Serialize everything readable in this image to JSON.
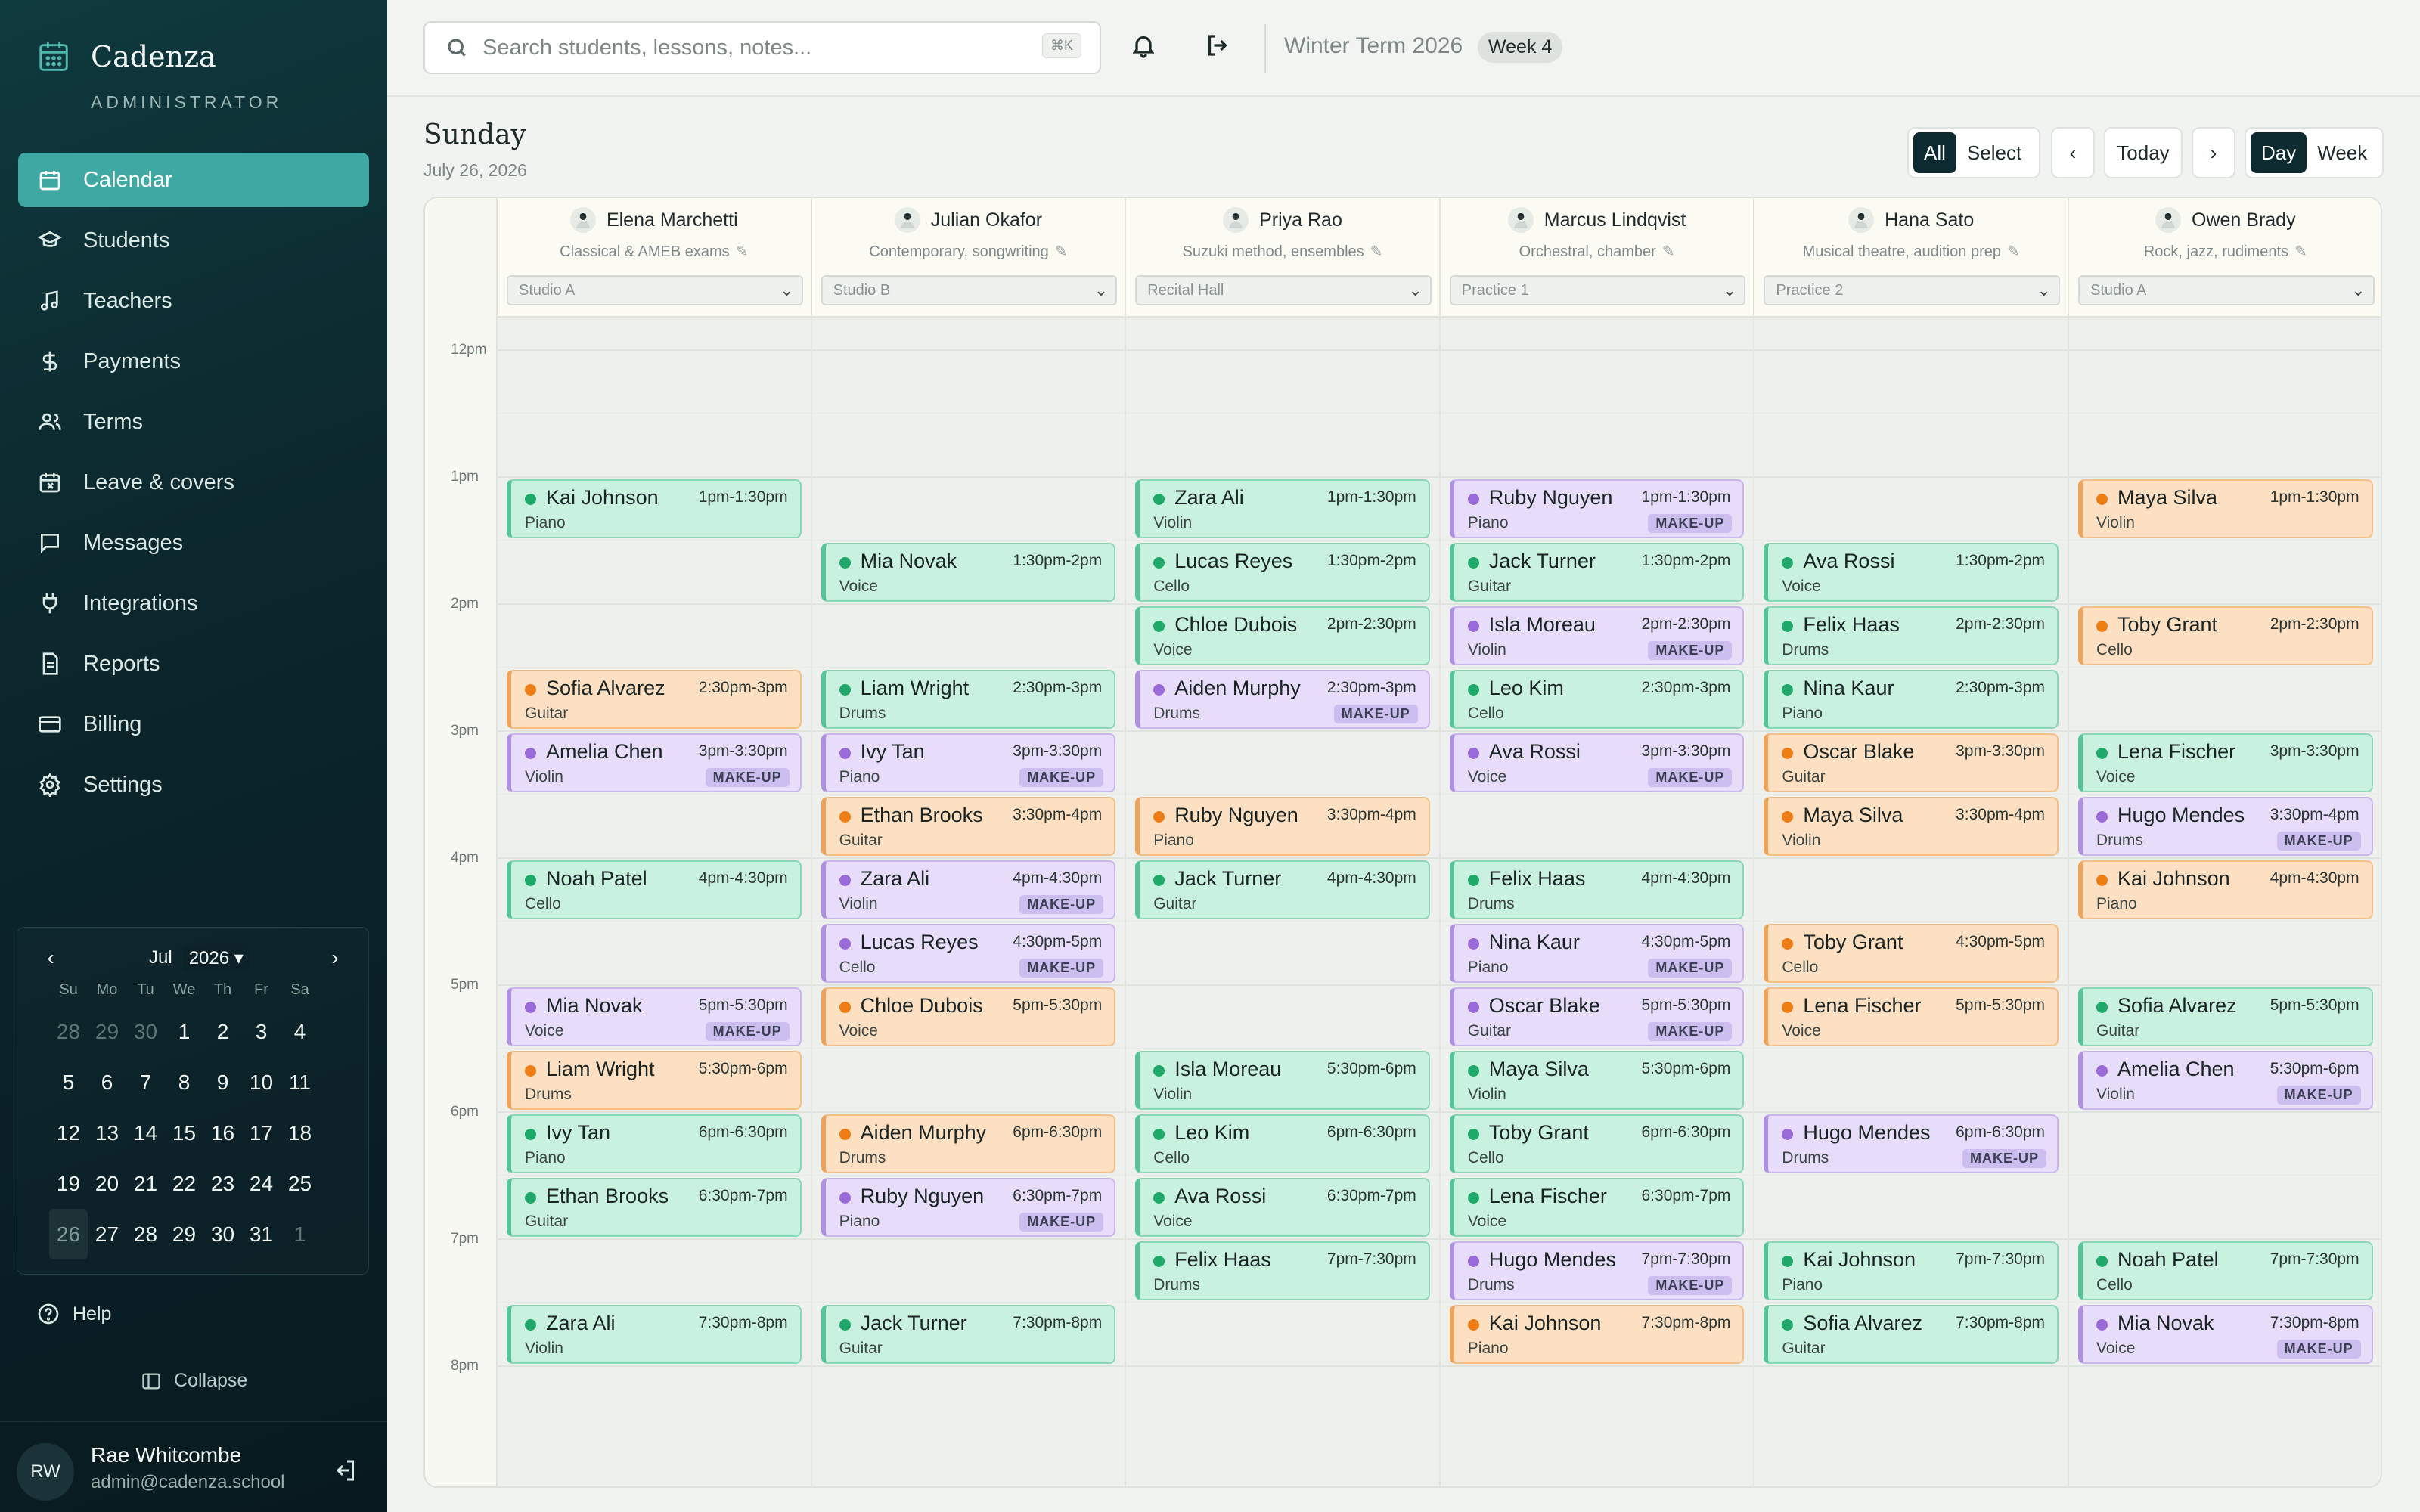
{
  "app": {
    "name": "Cadenza",
    "role": "ADMINISTRATOR"
  },
  "nav": [
    {
      "label": "Calendar",
      "icon": "calendar-icon",
      "active": true
    },
    {
      "label": "Students",
      "icon": "graduation-cap-icon"
    },
    {
      "label": "Teachers",
      "icon": "music-note-icon"
    },
    {
      "label": "Payments",
      "icon": "dollar-icon"
    },
    {
      "label": "Terms",
      "icon": "users-icon"
    },
    {
      "label": "Leave & covers",
      "icon": "calendar-x-icon"
    },
    {
      "label": "Messages",
      "icon": "message-icon"
    },
    {
      "label": "Integrations",
      "icon": "plug-icon"
    },
    {
      "label": "Reports",
      "icon": "document-icon"
    },
    {
      "label": "Billing",
      "icon": "credit-card-icon"
    },
    {
      "label": "Settings",
      "icon": "gear-icon"
    }
  ],
  "mini_calendar": {
    "month": "Jul",
    "year": "2026",
    "dow": [
      "Su",
      "Mo",
      "Tu",
      "We",
      "Th",
      "Fr",
      "Sa"
    ],
    "days": [
      "28",
      "29",
      "30",
      "1",
      "2",
      "3",
      "4",
      "5",
      "6",
      "7",
      "8",
      "9",
      "10",
      "11",
      "12",
      "13",
      "14",
      "15",
      "16",
      "17",
      "18",
      "19",
      "20",
      "21",
      "22",
      "23",
      "24",
      "25",
      "26",
      "27",
      "28",
      "29",
      "30",
      "31",
      "1"
    ],
    "muted": [
      0,
      1,
      2,
      34
    ],
    "today_index": 28
  },
  "help_label": "Help",
  "collapse_label": "Collapse",
  "user": {
    "initials": "RW",
    "name": "Rae Whitcombe",
    "email": "admin@cadenza.school"
  },
  "topbar": {
    "search_placeholder": "Search students, lessons, notes...",
    "shortcut": "⌘K",
    "term": "Winter Term 2026",
    "week": "Week 4"
  },
  "day": {
    "title": "Sunday",
    "date": "July 26, 2026"
  },
  "controls": {
    "all": "All",
    "select": "Select",
    "prev": "‹",
    "today": "Today",
    "next": "›",
    "day": "Day",
    "week": "Week"
  },
  "time_labels": [
    "12pm",
    "1pm",
    "2pm",
    "3pm",
    "4pm",
    "5pm",
    "6pm",
    "7pm",
    "8pm"
  ],
  "teachers": [
    {
      "name": "Elena Marchetti",
      "specialty": "Classical & AMEB exams",
      "room": "Studio A"
    },
    {
      "name": "Julian Okafor",
      "specialty": "Contemporary, songwriting",
      "room": "Studio B"
    },
    {
      "name": "Priya Rao",
      "specialty": "Suzuki method, ensembles",
      "room": "Recital Hall"
    },
    {
      "name": "Marcus Lindqvist",
      "specialty": "Orchestral, chamber",
      "room": "Practice 1"
    },
    {
      "name": "Hana Sato",
      "specialty": "Musical theatre, audition prep",
      "room": "Practice 2"
    },
    {
      "name": "Owen Brady",
      "specialty": "Rock, jazz, rudiments",
      "room": "Studio A"
    }
  ],
  "makeup_label": "MAKE-UP",
  "events": [
    {
      "col": 0,
      "slot": 2,
      "student": "Kai Johnson",
      "time": "1pm-1:30pm",
      "instrument": "Piano",
      "color": "green"
    },
    {
      "col": 0,
      "slot": 5,
      "student": "Sofia Alvarez",
      "time": "2:30pm-3pm",
      "instrument": "Guitar",
      "color": "orange"
    },
    {
      "col": 0,
      "slot": 6,
      "student": "Amelia Chen",
      "time": "3pm-3:30pm",
      "instrument": "Violin",
      "color": "purple",
      "makeup": true
    },
    {
      "col": 0,
      "slot": 8,
      "student": "Noah Patel",
      "time": "4pm-4:30pm",
      "instrument": "Cello",
      "color": "green"
    },
    {
      "col": 0,
      "slot": 10,
      "student": "Mia Novak",
      "time": "5pm-5:30pm",
      "instrument": "Voice",
      "color": "purple",
      "makeup": true
    },
    {
      "col": 0,
      "slot": 11,
      "student": "Liam Wright",
      "time": "5:30pm-6pm",
      "instrument": "Drums",
      "color": "orange"
    },
    {
      "col": 0,
      "slot": 12,
      "student": "Ivy Tan",
      "time": "6pm-6:30pm",
      "instrument": "Piano",
      "color": "green"
    },
    {
      "col": 0,
      "slot": 13,
      "student": "Ethan Brooks",
      "time": "6:30pm-7pm",
      "instrument": "Guitar",
      "color": "green"
    },
    {
      "col": 0,
      "slot": 15,
      "student": "Zara Ali",
      "time": "7:30pm-8pm",
      "instrument": "Violin",
      "color": "green"
    },
    {
      "col": 1,
      "slot": 3,
      "student": "Mia Novak",
      "time": "1:30pm-2pm",
      "instrument": "Voice",
      "color": "green"
    },
    {
      "col": 1,
      "slot": 5,
      "student": "Liam Wright",
      "time": "2:30pm-3pm",
      "instrument": "Drums",
      "color": "green"
    },
    {
      "col": 1,
      "slot": 6,
      "student": "Ivy Tan",
      "time": "3pm-3:30pm",
      "instrument": "Piano",
      "color": "purple",
      "makeup": true
    },
    {
      "col": 1,
      "slot": 7,
      "student": "Ethan Brooks",
      "time": "3:30pm-4pm",
      "instrument": "Guitar",
      "color": "orange"
    },
    {
      "col": 1,
      "slot": 8,
      "student": "Zara Ali",
      "time": "4pm-4:30pm",
      "instrument": "Violin",
      "color": "purple",
      "makeup": true
    },
    {
      "col": 1,
      "slot": 9,
      "student": "Lucas Reyes",
      "time": "4:30pm-5pm",
      "instrument": "Cello",
      "color": "purple",
      "makeup": true
    },
    {
      "col": 1,
      "slot": 10,
      "student": "Chloe Dubois",
      "time": "5pm-5:30pm",
      "instrument": "Voice",
      "color": "orange"
    },
    {
      "col": 1,
      "slot": 12,
      "student": "Aiden Murphy",
      "time": "6pm-6:30pm",
      "instrument": "Drums",
      "color": "orange"
    },
    {
      "col": 1,
      "slot": 13,
      "student": "Ruby Nguyen",
      "time": "6:30pm-7pm",
      "instrument": "Piano",
      "color": "purple",
      "makeup": true
    },
    {
      "col": 1,
      "slot": 15,
      "student": "Jack Turner",
      "time": "7:30pm-8pm",
      "instrument": "Guitar",
      "color": "green"
    },
    {
      "col": 2,
      "slot": 2,
      "student": "Zara Ali",
      "time": "1pm-1:30pm",
      "instrument": "Violin",
      "color": "green"
    },
    {
      "col": 2,
      "slot": 3,
      "student": "Lucas Reyes",
      "time": "1:30pm-2pm",
      "instrument": "Cello",
      "color": "green"
    },
    {
      "col": 2,
      "slot": 4,
      "student": "Chloe Dubois",
      "time": "2pm-2:30pm",
      "instrument": "Voice",
      "color": "green"
    },
    {
      "col": 2,
      "slot": 5,
      "student": "Aiden Murphy",
      "time": "2:30pm-3pm",
      "instrument": "Drums",
      "color": "purple",
      "makeup": true
    },
    {
      "col": 2,
      "slot": 7,
      "student": "Ruby Nguyen",
      "time": "3:30pm-4pm",
      "instrument": "Piano",
      "color": "orange"
    },
    {
      "col": 2,
      "slot": 8,
      "student": "Jack Turner",
      "time": "4pm-4:30pm",
      "instrument": "Guitar",
      "color": "green"
    },
    {
      "col": 2,
      "slot": 11,
      "student": "Isla Moreau",
      "time": "5:30pm-6pm",
      "instrument": "Violin",
      "color": "green"
    },
    {
      "col": 2,
      "slot": 12,
      "student": "Leo Kim",
      "time": "6pm-6:30pm",
      "instrument": "Cello",
      "color": "green"
    },
    {
      "col": 2,
      "slot": 13,
      "student": "Ava Rossi",
      "time": "6:30pm-7pm",
      "instrument": "Voice",
      "color": "green"
    },
    {
      "col": 2,
      "slot": 14,
      "student": "Felix Haas",
      "time": "7pm-7:30pm",
      "instrument": "Drums",
      "color": "green"
    },
    {
      "col": 3,
      "slot": 2,
      "student": "Ruby Nguyen",
      "time": "1pm-1:30pm",
      "instrument": "Piano",
      "color": "purple",
      "makeup": true
    },
    {
      "col": 3,
      "slot": 3,
      "student": "Jack Turner",
      "time": "1:30pm-2pm",
      "instrument": "Guitar",
      "color": "green"
    },
    {
      "col": 3,
      "slot": 4,
      "student": "Isla Moreau",
      "time": "2pm-2:30pm",
      "instrument": "Violin",
      "color": "purple",
      "makeup": true
    },
    {
      "col": 3,
      "slot": 5,
      "student": "Leo Kim",
      "time": "2:30pm-3pm",
      "instrument": "Cello",
      "color": "green"
    },
    {
      "col": 3,
      "slot": 6,
      "student": "Ava Rossi",
      "time": "3pm-3:30pm",
      "instrument": "Voice",
      "color": "purple",
      "makeup": true
    },
    {
      "col": 3,
      "slot": 8,
      "student": "Felix Haas",
      "time": "4pm-4:30pm",
      "instrument": "Drums",
      "color": "green"
    },
    {
      "col": 3,
      "slot": 9,
      "student": "Nina Kaur",
      "time": "4:30pm-5pm",
      "instrument": "Piano",
      "color": "purple",
      "makeup": true
    },
    {
      "col": 3,
      "slot": 10,
      "student": "Oscar Blake",
      "time": "5pm-5:30pm",
      "instrument": "Guitar",
      "color": "purple",
      "makeup": true
    },
    {
      "col": 3,
      "slot": 11,
      "student": "Maya Silva",
      "time": "5:30pm-6pm",
      "instrument": "Violin",
      "color": "green"
    },
    {
      "col": 3,
      "slot": 12,
      "student": "Toby Grant",
      "time": "6pm-6:30pm",
      "instrument": "Cello",
      "color": "green"
    },
    {
      "col": 3,
      "slot": 13,
      "student": "Lena Fischer",
      "time": "6:30pm-7pm",
      "instrument": "Voice",
      "color": "green"
    },
    {
      "col": 3,
      "slot": 14,
      "student": "Hugo Mendes",
      "time": "7pm-7:30pm",
      "instrument": "Drums",
      "color": "purple",
      "makeup": true
    },
    {
      "col": 3,
      "slot": 15,
      "student": "Kai Johnson",
      "time": "7:30pm-8pm",
      "instrument": "Piano",
      "color": "orange"
    },
    {
      "col": 4,
      "slot": 3,
      "student": "Ava Rossi",
      "time": "1:30pm-2pm",
      "instrument": "Voice",
      "color": "green"
    },
    {
      "col": 4,
      "slot": 4,
      "student": "Felix Haas",
      "time": "2pm-2:30pm",
      "instrument": "Drums",
      "color": "green"
    },
    {
      "col": 4,
      "slot": 5,
      "student": "Nina Kaur",
      "time": "2:30pm-3pm",
      "instrument": "Piano",
      "color": "green"
    },
    {
      "col": 4,
      "slot": 6,
      "student": "Oscar Blake",
      "time": "3pm-3:30pm",
      "instrument": "Guitar",
      "color": "orange"
    },
    {
      "col": 4,
      "slot": 7,
      "student": "Maya Silva",
      "time": "3:30pm-4pm",
      "instrument": "Violin",
      "color": "orange"
    },
    {
      "col": 4,
      "slot": 9,
      "student": "Toby Grant",
      "time": "4:30pm-5pm",
      "instrument": "Cello",
      "color": "orange"
    },
    {
      "col": 4,
      "slot": 10,
      "student": "Lena Fischer",
      "time": "5pm-5:30pm",
      "instrument": "Voice",
      "color": "orange"
    },
    {
      "col": 4,
      "slot": 12,
      "student": "Hugo Mendes",
      "time": "6pm-6:30pm",
      "instrument": "Drums",
      "color": "purple",
      "makeup": true
    },
    {
      "col": 4,
      "slot": 14,
      "student": "Kai Johnson",
      "time": "7pm-7:30pm",
      "instrument": "Piano",
      "color": "green"
    },
    {
      "col": 4,
      "slot": 15,
      "student": "Sofia Alvarez",
      "time": "7:30pm-8pm",
      "instrument": "Guitar",
      "color": "green"
    },
    {
      "col": 5,
      "slot": 2,
      "student": "Maya Silva",
      "time": "1pm-1:30pm",
      "instrument": "Violin",
      "color": "orange"
    },
    {
      "col": 5,
      "slot": 4,
      "student": "Toby Grant",
      "time": "2pm-2:30pm",
      "instrument": "Cello",
      "color": "orange"
    },
    {
      "col": 5,
      "slot": 6,
      "student": "Lena Fischer",
      "time": "3pm-3:30pm",
      "instrument": "Voice",
      "color": "green"
    },
    {
      "col": 5,
      "slot": 7,
      "student": "Hugo Mendes",
      "time": "3:30pm-4pm",
      "instrument": "Drums",
      "color": "purple",
      "makeup": true
    },
    {
      "col": 5,
      "slot": 8,
      "student": "Kai Johnson",
      "time": "4pm-4:30pm",
      "instrument": "Piano",
      "color": "orange"
    },
    {
      "col": 5,
      "slot": 10,
      "student": "Sofia Alvarez",
      "time": "5pm-5:30pm",
      "instrument": "Guitar",
      "color": "green"
    },
    {
      "col": 5,
      "slot": 11,
      "student": "Amelia Chen",
      "time": "5:30pm-6pm",
      "instrument": "Violin",
      "color": "purple",
      "makeup": true
    },
    {
      "col": 5,
      "slot": 14,
      "student": "Noah Patel",
      "time": "7pm-7:30pm",
      "instrument": "Cello",
      "color": "green"
    },
    {
      "col": 5,
      "slot": 15,
      "student": "Mia Novak",
      "time": "7:30pm-8pm",
      "instrument": "Voice",
      "color": "purple",
      "makeup": true
    }
  ]
}
